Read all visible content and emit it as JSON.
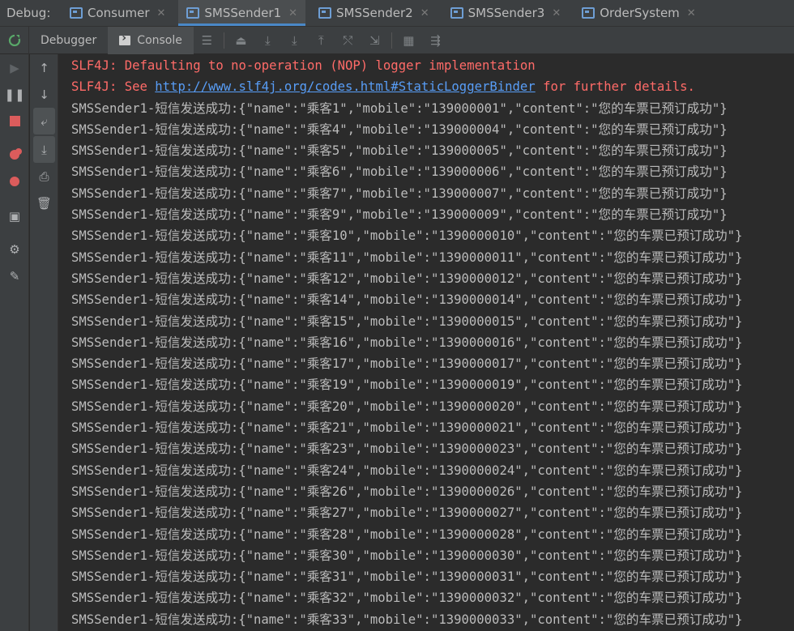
{
  "debug_label": "Debug:",
  "run_tabs": [
    {
      "label": "Consumer",
      "active": false
    },
    {
      "label": "SMSSender1",
      "active": true
    },
    {
      "label": "SMSSender2",
      "active": false
    },
    {
      "label": "SMSSender3",
      "active": false
    },
    {
      "label": "OrderSystem",
      "active": false
    }
  ],
  "subtabs": {
    "debugger": "Debugger",
    "console": "Console"
  },
  "colors": {
    "error": "#ff6b68",
    "link": "#589df6",
    "accent": "#4a88c7",
    "rerun": "#59a869",
    "stop": "#db5c5c"
  },
  "console": {
    "slf4j_line1": "SLF4J: Defaulting to no-operation (NOP) logger implementation",
    "slf4j_line2_prefix": "SLF4J: See ",
    "slf4j_link": "http://www.slf4j.org/codes.html#StaticLoggerBinder",
    "slf4j_line2_suffix": " for further details.",
    "lines": [
      "SMSSender1-短信发送成功:{\"name\":\"乘客1\",\"mobile\":\"139000001\",\"content\":\"您的车票已预订成功\"}",
      "SMSSender1-短信发送成功:{\"name\":\"乘客4\",\"mobile\":\"139000004\",\"content\":\"您的车票已预订成功\"}",
      "SMSSender1-短信发送成功:{\"name\":\"乘客5\",\"mobile\":\"139000005\",\"content\":\"您的车票已预订成功\"}",
      "SMSSender1-短信发送成功:{\"name\":\"乘客6\",\"mobile\":\"139000006\",\"content\":\"您的车票已预订成功\"}",
      "SMSSender1-短信发送成功:{\"name\":\"乘客7\",\"mobile\":\"139000007\",\"content\":\"您的车票已预订成功\"}",
      "SMSSender1-短信发送成功:{\"name\":\"乘客9\",\"mobile\":\"139000009\",\"content\":\"您的车票已预订成功\"}",
      "SMSSender1-短信发送成功:{\"name\":\"乘客10\",\"mobile\":\"1390000010\",\"content\":\"您的车票已预订成功\"}",
      "SMSSender1-短信发送成功:{\"name\":\"乘客11\",\"mobile\":\"1390000011\",\"content\":\"您的车票已预订成功\"}",
      "SMSSender1-短信发送成功:{\"name\":\"乘客12\",\"mobile\":\"1390000012\",\"content\":\"您的车票已预订成功\"}",
      "SMSSender1-短信发送成功:{\"name\":\"乘客14\",\"mobile\":\"1390000014\",\"content\":\"您的车票已预订成功\"}",
      "SMSSender1-短信发送成功:{\"name\":\"乘客15\",\"mobile\":\"1390000015\",\"content\":\"您的车票已预订成功\"}",
      "SMSSender1-短信发送成功:{\"name\":\"乘客16\",\"mobile\":\"1390000016\",\"content\":\"您的车票已预订成功\"}",
      "SMSSender1-短信发送成功:{\"name\":\"乘客17\",\"mobile\":\"1390000017\",\"content\":\"您的车票已预订成功\"}",
      "SMSSender1-短信发送成功:{\"name\":\"乘客19\",\"mobile\":\"1390000019\",\"content\":\"您的车票已预订成功\"}",
      "SMSSender1-短信发送成功:{\"name\":\"乘客20\",\"mobile\":\"1390000020\",\"content\":\"您的车票已预订成功\"}",
      "SMSSender1-短信发送成功:{\"name\":\"乘客21\",\"mobile\":\"1390000021\",\"content\":\"您的车票已预订成功\"}",
      "SMSSender1-短信发送成功:{\"name\":\"乘客23\",\"mobile\":\"1390000023\",\"content\":\"您的车票已预订成功\"}",
      "SMSSender1-短信发送成功:{\"name\":\"乘客24\",\"mobile\":\"1390000024\",\"content\":\"您的车票已预订成功\"}",
      "SMSSender1-短信发送成功:{\"name\":\"乘客26\",\"mobile\":\"1390000026\",\"content\":\"您的车票已预订成功\"}",
      "SMSSender1-短信发送成功:{\"name\":\"乘客27\",\"mobile\":\"1390000027\",\"content\":\"您的车票已预订成功\"}",
      "SMSSender1-短信发送成功:{\"name\":\"乘客28\",\"mobile\":\"1390000028\",\"content\":\"您的车票已预订成功\"}",
      "SMSSender1-短信发送成功:{\"name\":\"乘客30\",\"mobile\":\"1390000030\",\"content\":\"您的车票已预订成功\"}",
      "SMSSender1-短信发送成功:{\"name\":\"乘客31\",\"mobile\":\"1390000031\",\"content\":\"您的车票已预订成功\"}",
      "SMSSender1-短信发送成功:{\"name\":\"乘客32\",\"mobile\":\"1390000032\",\"content\":\"您的车票已预订成功\"}",
      "SMSSender1-短信发送成功:{\"name\":\"乘客33\",\"mobile\":\"1390000033\",\"content\":\"您的车票已预订成功\"}"
    ]
  }
}
